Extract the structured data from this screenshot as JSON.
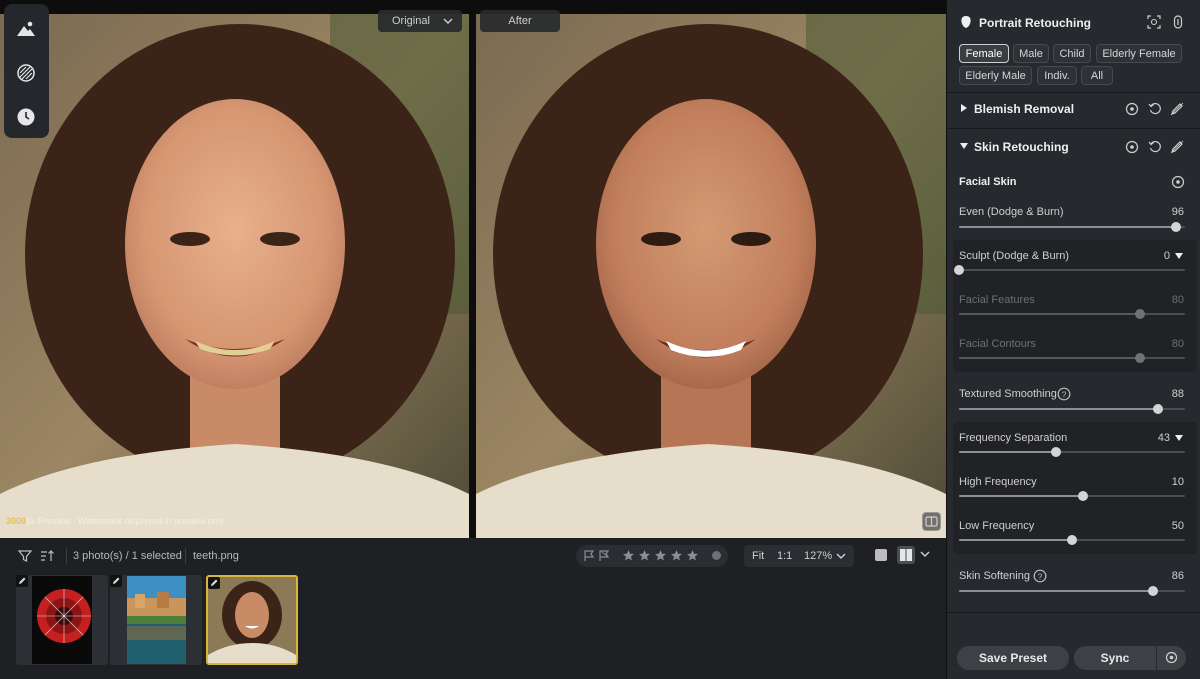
{
  "compare": {
    "original_label": "Original",
    "after_label": "After"
  },
  "watermark": {
    "brand": "3000",
    "text": "px Preview · Watermark displayed in preview only"
  },
  "filmstrip": {
    "selection_text": "3 photo(s) / 1 selected",
    "file_name": "teeth.png",
    "zoom_fit": "Fit",
    "zoom_1to1": "1:1",
    "zoom_level": "127%",
    "rating_stars": 0
  },
  "panel": {
    "title": "Portrait Retouching",
    "presets": [
      "Female",
      "Male",
      "Child",
      "Elderly Female",
      "Elderly Male",
      "Indiv.",
      "All"
    ],
    "active_preset": "Female",
    "sections": {
      "blemish": "Blemish Removal",
      "skin": "Skin Retouching",
      "facial_skin": "Facial Skin"
    },
    "sliders": {
      "even": {
        "label": "Even (Dodge & Burn)",
        "value": "96",
        "level": 0.96
      },
      "sculpt": {
        "label": "Sculpt (Dodge & Burn)",
        "value": "0",
        "level": 0.0
      },
      "features": {
        "label": "Facial Features",
        "value": "80",
        "level": 0.8
      },
      "contours": {
        "label": "Facial Contours",
        "value": "80",
        "level": 0.8
      },
      "textured": {
        "label": "Textured Smoothing",
        "value": "88",
        "level": 0.88
      },
      "freqsep": {
        "label": "Frequency Separation",
        "value": "43",
        "level": 0.43
      },
      "high": {
        "label": "High Frequency",
        "value": "10",
        "level": 0.55
      },
      "low": {
        "label": "Low Frequency",
        "value": "50",
        "level": 0.5
      },
      "softening": {
        "label": "Skin Softening",
        "value": "86",
        "level": 0.86
      }
    },
    "buttons": {
      "save_preset": "Save Preset",
      "sync": "Sync"
    }
  },
  "colors": {
    "accent": "#d9b53a",
    "panel_bg": "#26292d",
    "app_bg": "#1b1d20"
  }
}
